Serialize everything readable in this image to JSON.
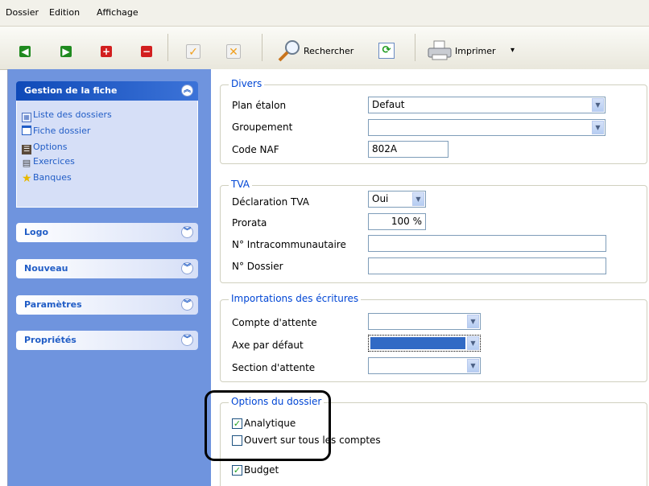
{
  "menu": {
    "items": [
      "Dossier",
      "Edition",
      "Affichage"
    ]
  },
  "toolbar": {
    "search_label": "Rechercher",
    "print_label": "Imprimer",
    "print_dropdown": "▾"
  },
  "sidebar": {
    "gestion": {
      "title": "Gestion de la fiche",
      "items": [
        {
          "label": "Liste des dossiers",
          "icon": "list-grid-icon"
        },
        {
          "label": "Fiche dossier",
          "icon": "window-icon"
        },
        {
          "label": "Options",
          "icon": "options-icon"
        },
        {
          "label": "Exercices",
          "icon": "calendar-icon"
        },
        {
          "label": "Banques",
          "icon": "star-icon"
        }
      ]
    },
    "panels": [
      {
        "title": "Logo"
      },
      {
        "title": "Nouveau"
      },
      {
        "title": "Paramètres"
      },
      {
        "title": "Propriétés"
      }
    ]
  },
  "divers": {
    "title": "Divers",
    "plan_etalon_label": "Plan étalon",
    "plan_etalon_value": "Defaut",
    "groupement_label": "Groupement",
    "groupement_value": "",
    "code_naf_label": "Code NAF",
    "code_naf_value": "802A"
  },
  "tva": {
    "title": "TVA",
    "declaration_label": "Déclaration TVA",
    "declaration_value": "Oui",
    "prorata_label": "Prorata",
    "prorata_value": "100 %",
    "intracom_label": "N° Intracommunautaire",
    "intracom_value": "",
    "dossier_label": "N° Dossier",
    "dossier_value": ""
  },
  "importations": {
    "title": "Importations des écritures",
    "compte_attente_label": "Compte d'attente",
    "axe_defaut_label": "Axe par défaut",
    "section_attente_label": "Section d'attente"
  },
  "options": {
    "title": "Options du dossier",
    "analytique_label": "Analytique",
    "analytique_checked": true,
    "ouvert_label": "Ouvert sur tous les comptes",
    "ouvert_checked": false,
    "budget_label": "Budget",
    "budget_checked": true
  },
  "colors": {
    "sidebar_bg": "#6f94de",
    "panel_title": "#215dc6",
    "group_title": "#0046d5",
    "selection": "#316ac5"
  }
}
